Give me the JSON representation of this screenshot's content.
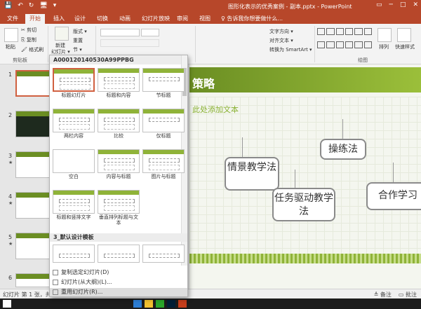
{
  "titlebar": {
    "qat": [
      "💾",
      "↶",
      "↻",
      "🖥",
      "▾"
    ],
    "title": "图形化表示的优秀案例 - 副本.pptx - PowerPoint",
    "controls": [
      "▭",
      "─",
      "□",
      "✕"
    ]
  },
  "tabs": {
    "items": [
      "文件",
      "开始",
      "插入",
      "设计",
      "切换",
      "动画",
      "幻灯片放映",
      "审阅",
      "视图"
    ],
    "active_index": 1,
    "tell_me": "♀ 告诉我你想要做什么..."
  },
  "ribbon": {
    "paste_label": "粘贴",
    "cut": "✂ 剪切",
    "copy": "⎘ 复制",
    "format_painter": "🖌 格式刷",
    "clipboard_group": "剪贴板",
    "new_slide_line1": "新建",
    "new_slide_line2": "幻灯片 ▾",
    "layout": "版式 ▾",
    "reset": "重置",
    "section": "节 ▾",
    "text_direction": "文字方向 ▾",
    "align_text": "对齐文本 ▾",
    "smartart": "转换为 SmartArt ▾",
    "arrange": "排列",
    "quick_styles": "快速样式",
    "drawing_group": "绘图"
  },
  "slides_panel": {
    "numbers": [
      "1",
      "2",
      "3",
      "4",
      "5",
      "6"
    ],
    "star": "★"
  },
  "dropdown": {
    "header": "A000120140530A99PPBG",
    "layouts": [
      {
        "label": "标题幻灯片"
      },
      {
        "label": "标题和内容"
      },
      {
        "label": "节标题"
      },
      {
        "label": "两栏内容"
      },
      {
        "label": "比较"
      },
      {
        "label": "仅标题"
      },
      {
        "label": "空白"
      },
      {
        "label": "内容与标题"
      },
      {
        "label": "图片与标题"
      },
      {
        "label": "标题和竖排文字"
      },
      {
        "label": "垂直排列标题与文本"
      }
    ],
    "section2": "3_默认设计模板",
    "menu": [
      "复制选定幻灯片(D)",
      "幻灯片(从大纲)(L)...",
      "重用幻灯片(R)..."
    ]
  },
  "slide": {
    "title": "策略",
    "subtitle": "此处添加文本",
    "signs": [
      "情景教学法",
      "操练法",
      "任务驱动教学法",
      "合作学习"
    ]
  },
  "status": {
    "left": "幻灯片 第 1 张，共 1",
    "notes": "≜ 备注",
    "comments": "▭ 批注"
  }
}
